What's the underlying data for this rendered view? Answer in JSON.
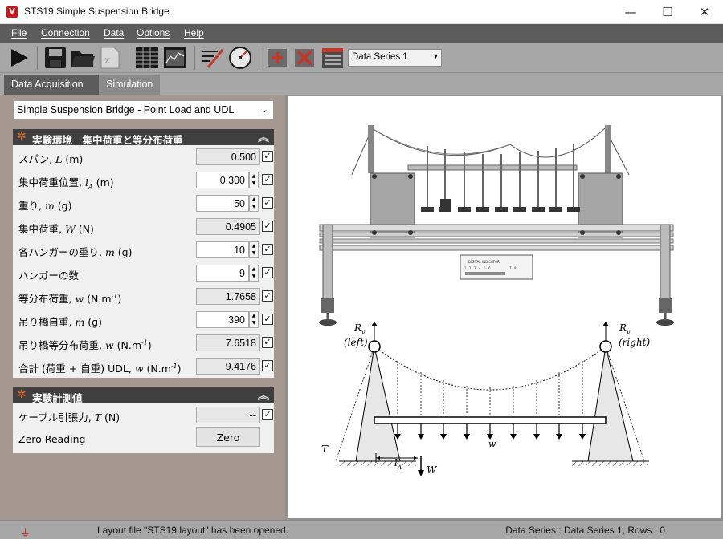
{
  "window": {
    "title": "STS19 Simple Suspension Bridge",
    "app_icon": "V",
    "controls": {
      "minimize": "—",
      "maximize": "☐",
      "close": "✕"
    }
  },
  "menu": {
    "items": [
      {
        "label": "File"
      },
      {
        "label": "Connection"
      },
      {
        "label": "Data"
      },
      {
        "label": "Options"
      },
      {
        "label": "Help"
      }
    ]
  },
  "toolbar": {
    "icons": [
      "play-icon",
      "save-icon",
      "open-folder-icon",
      "export-excel-icon",
      "table-view-icon",
      "chart-view-icon",
      "edit-icon",
      "gauge-icon",
      "add-series-icon",
      "delete-series-icon",
      "series-table-icon"
    ],
    "series_select": {
      "value": "Data Series 1"
    }
  },
  "tabs": [
    {
      "label": "Data Acquisition"
    },
    {
      "label": "Simulation"
    }
  ],
  "experiment_select": {
    "value": "Simple Suspension Bridge - Point Load and UDL"
  },
  "section_env": {
    "title": "実験環境　集中荷重と等分布荷重",
    "rows": [
      {
        "label": "スパン, ",
        "sym": "L",
        "unit": " (m)",
        "value": "0.500"
      },
      {
        "label": "集中荷重位置, ",
        "sym": "l",
        "sub": "A",
        "unit": " (m)",
        "value": "0.300"
      },
      {
        "label": "重り, ",
        "sym": "m",
        "unit": " (g)",
        "value": "50"
      },
      {
        "label": "集中荷重, ",
        "sym": "W",
        "unit": " (N)",
        "value": "0.4905"
      },
      {
        "label": "各ハンガーの重り, ",
        "sym": "m",
        "unit": " (g)",
        "value": "10"
      },
      {
        "label": "ハンガーの数",
        "sym": "",
        "unit": "",
        "value": "9"
      },
      {
        "label": "等分布荷重, ",
        "sym": "w",
        "unit": " (N.m",
        "sup": "-1",
        "unit2": ")",
        "value": "1.7658"
      },
      {
        "label": "吊り橋自重, ",
        "sym": "m",
        "unit": " (g)",
        "value": "390"
      },
      {
        "label": "吊り橋等分布荷重, ",
        "sym": "w",
        "unit": " (N.m",
        "sup": "-1",
        "unit2": ")",
        "value": "7.6518"
      },
      {
        "label": "合計 (荷重 + 自重) UDL, ",
        "sym": "w",
        "unit": " (N.m",
        "sup": "-1",
        "unit2": ")",
        "value": "9.4176"
      }
    ]
  },
  "section_meas": {
    "title": "実験計測値",
    "rows": [
      {
        "label": "ケーブル引張力, ",
        "sym": "T",
        "unit": " (N)",
        "value": "--"
      }
    ],
    "zero_label": "Zero Reading",
    "zero_button": "Zero"
  },
  "diagram": {
    "labels": {
      "Rv_left": "R",
      "Rv_left_sub": "v",
      "left": "(left)",
      "Rv_right": "R",
      "Rv_right_sub": "v",
      "right": "(right)",
      "w": "w",
      "T": "T",
      "lA": "l",
      "lA_sub": "A",
      "W": "W"
    },
    "panel_text": "DIGITAL INDICATOR",
    "panel_digits": [
      "1",
      "2",
      "3",
      "4",
      "5",
      "6",
      "7",
      "8"
    ]
  },
  "status": {
    "message": "Layout file \"STS19.layout\" has been opened.",
    "series": "Data Series : Data Series 1,  Rows : 0"
  }
}
